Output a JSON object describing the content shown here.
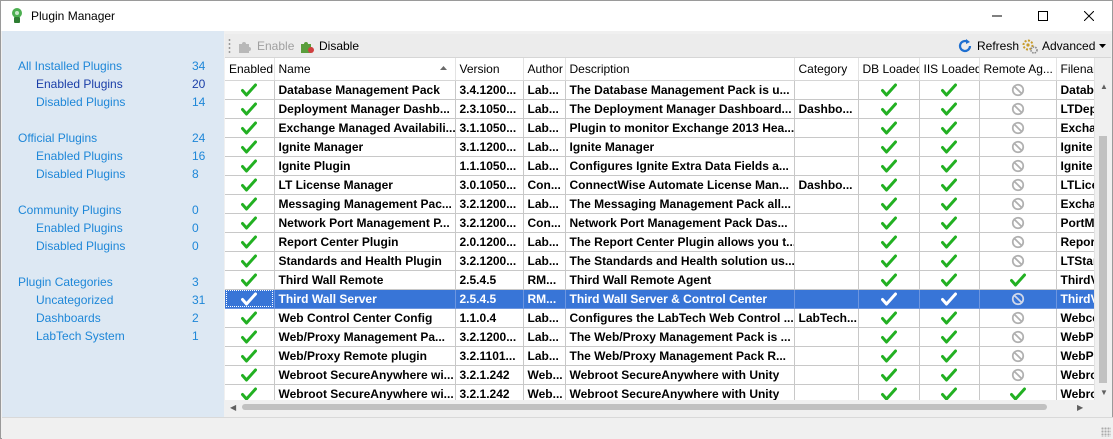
{
  "window": {
    "title": "Plugin Manager"
  },
  "sidebar": {
    "groups": [
      {
        "label": "All Installed Plugins",
        "count": "34",
        "items": [
          {
            "label": "Enabled Plugins",
            "count": "20",
            "selected": true
          },
          {
            "label": "Disabled Plugins",
            "count": "14"
          }
        ]
      },
      {
        "label": "Official Plugins",
        "count": "24",
        "items": [
          {
            "label": "Enabled Plugins",
            "count": "16"
          },
          {
            "label": "Disabled Plugins",
            "count": "8"
          }
        ]
      },
      {
        "label": "Community Plugins",
        "count": "0",
        "items": [
          {
            "label": "Enabled Plugins",
            "count": "0"
          },
          {
            "label": "Disabled Plugins",
            "count": "0"
          }
        ]
      },
      {
        "label": "Plugin Categories",
        "count": "3",
        "items": [
          {
            "label": "Uncategorized",
            "count": "31"
          },
          {
            "label": "Dashboards",
            "count": "2"
          },
          {
            "label": "LabTech System",
            "count": "1"
          }
        ]
      }
    ]
  },
  "toolbar": {
    "enable_label": "Enable",
    "disable_label": "Disable",
    "refresh_label": "Refresh",
    "advanced_label": "Advanced"
  },
  "colors": {
    "check": "#22b022",
    "no": "#b0b0b0",
    "selection": "#3875d7",
    "link": "#1e87d8"
  },
  "table": {
    "columns": [
      "Enabled",
      "Name",
      "Version",
      "Author",
      "Description",
      "Category",
      "DB Loaded",
      "IIS Loaded",
      "Remote Ag...",
      "Filename"
    ],
    "selected_row": 11,
    "rows": [
      {
        "name": "Database Management Pack",
        "version": "3.4.1200...",
        "author": "Lab...",
        "description": "The Database Management Pack is u...",
        "category": "",
        "db": true,
        "iis": true,
        "remote": false,
        "filename": "Datab"
      },
      {
        "name": "Deployment Manager Dashb...",
        "version": "2.3.1050...",
        "author": "Lab...",
        "description": "The Deployment Manager Dashboard...",
        "category": "Dashbo...",
        "db": true,
        "iis": true,
        "remote": false,
        "filename": "LTDep"
      },
      {
        "name": "Exchange Managed Availabili...",
        "version": "3.1.1050...",
        "author": "Lab...",
        "description": "Plugin to monitor Exchange 2013 Hea...",
        "category": "",
        "db": true,
        "iis": true,
        "remote": false,
        "filename": "Excha"
      },
      {
        "name": "Ignite Manager",
        "version": "3.1.1200...",
        "author": "Lab...",
        "description": "Ignite Manager",
        "category": "",
        "db": true,
        "iis": true,
        "remote": false,
        "filename": "Ignite"
      },
      {
        "name": "Ignite Plugin",
        "version": "1.1.1050...",
        "author": "Lab...",
        "description": "Configures Ignite Extra Data Fields a...",
        "category": "",
        "db": true,
        "iis": true,
        "remote": false,
        "filename": "Ignite"
      },
      {
        "name": "LT License Manager",
        "version": "3.0.1050...",
        "author": "Con...",
        "description": "ConnectWise Automate License Man...",
        "category": "Dashbo...",
        "db": true,
        "iis": true,
        "remote": false,
        "filename": "LTLice"
      },
      {
        "name": "Messaging Management Pac...",
        "version": "3.2.1200...",
        "author": "Lab...",
        "description": "The Messaging Management Pack all...",
        "category": "",
        "db": true,
        "iis": true,
        "remote": false,
        "filename": "Excha"
      },
      {
        "name": "Network Port Management P...",
        "version": "3.2.1200...",
        "author": "Con...",
        "description": "Network Port Management Pack Das...",
        "category": "",
        "db": true,
        "iis": true,
        "remote": false,
        "filename": "PortM"
      },
      {
        "name": "Report Center Plugin",
        "version": "2.0.1200...",
        "author": "Lab...",
        "description": "The Report Center Plugin allows you t...",
        "category": "",
        "db": true,
        "iis": true,
        "remote": false,
        "filename": "Repor"
      },
      {
        "name": "Standards and Health Plugin",
        "version": "3.2.1200...",
        "author": "Lab...",
        "description": "The Standards and Health solution us...",
        "category": "",
        "db": true,
        "iis": true,
        "remote": false,
        "filename": "LTStar"
      },
      {
        "name": "Third Wall Remote",
        "version": "2.5.4.5",
        "author": "RM...",
        "description": "Third Wall Remote Agent",
        "category": "",
        "db": true,
        "iis": true,
        "remote": true,
        "filename": "ThirdV"
      },
      {
        "name": "Third Wall Server",
        "version": "2.5.4.5",
        "author": "RM...",
        "description": "Third Wall Server & Control Center",
        "category": "",
        "db": true,
        "iis": true,
        "remote": false,
        "filename": "ThirdV"
      },
      {
        "name": "Web Control Center Config",
        "version": "1.1.0.4",
        "author": "Lab...",
        "description": "Configures the LabTech Web Control ...",
        "category": "LabTech...",
        "db": true,
        "iis": true,
        "remote": false,
        "filename": "Webcc"
      },
      {
        "name": "Web/Proxy Management Pa...",
        "version": "3.2.1200...",
        "author": "Lab...",
        "description": "The Web/Proxy Management Pack is ...",
        "category": "",
        "db": true,
        "iis": true,
        "remote": false,
        "filename": "WebP"
      },
      {
        "name": "Web/Proxy Remote plugin",
        "version": "3.2.1101...",
        "author": "Lab...",
        "description": "The Web/Proxy Management Pack R...",
        "category": "",
        "db": true,
        "iis": true,
        "remote": false,
        "filename": "WebP"
      },
      {
        "name": "Webroot SecureAnywhere wi...",
        "version": "3.2.1.242",
        "author": "Web...",
        "description": "Webroot SecureAnywhere with Unity",
        "category": "",
        "db": true,
        "iis": true,
        "remote": false,
        "filename": "Webrc"
      },
      {
        "name": "Webroot SecureAnywhere wi...",
        "version": "3.2.1.242",
        "author": "Web...",
        "description": "Webroot SecureAnywhere with Unity",
        "category": "",
        "db": true,
        "iis": true,
        "remote": true,
        "filename": "Webrc"
      }
    ]
  }
}
